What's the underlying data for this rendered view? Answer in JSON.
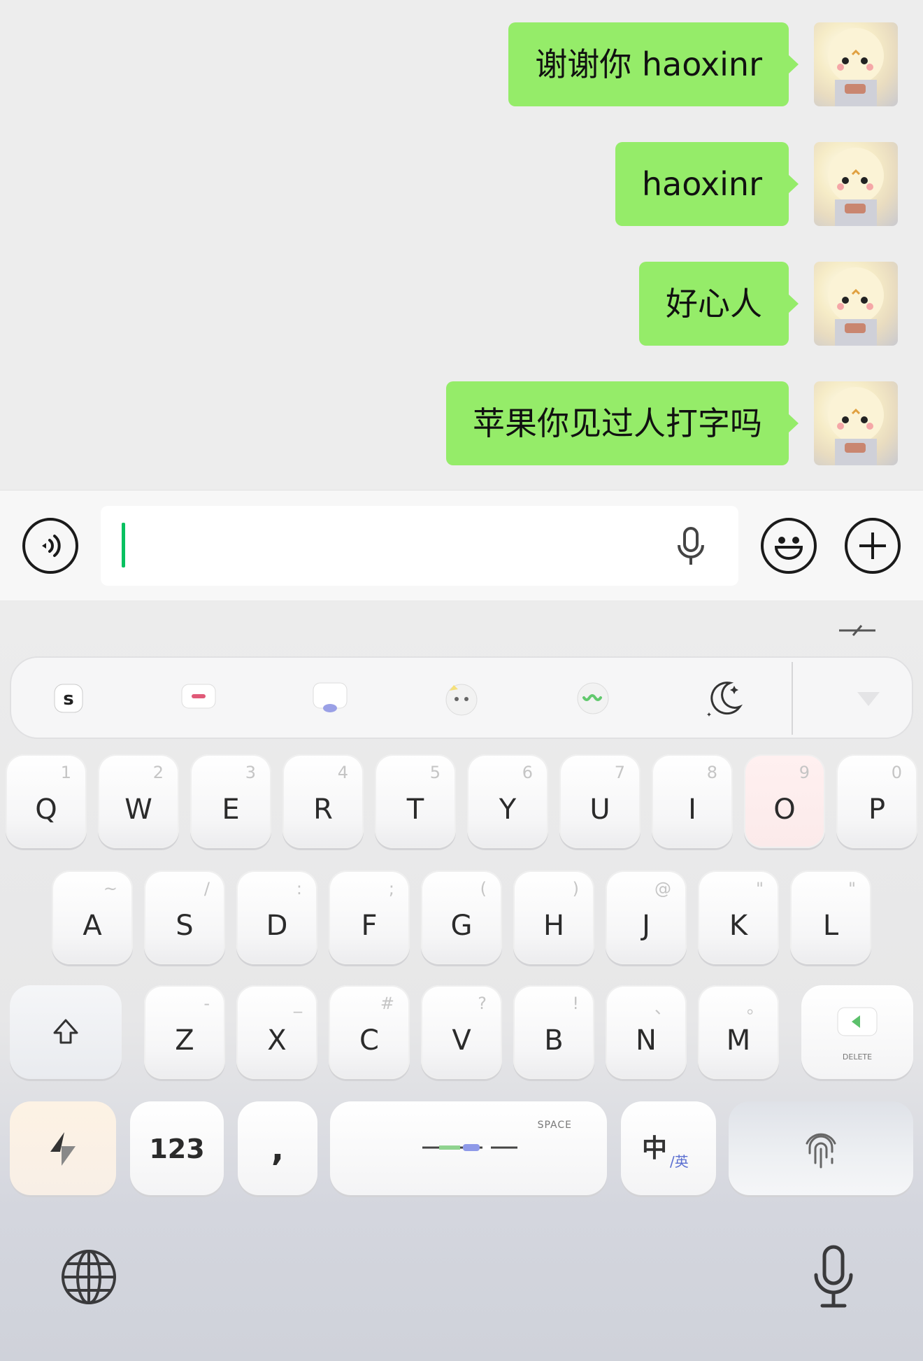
{
  "chat": {
    "messages": [
      {
        "text": "谢谢你 haoxinr",
        "from": "me"
      },
      {
        "text": "haoxinr",
        "from": "me"
      },
      {
        "text": "好心人",
        "from": "me"
      },
      {
        "text": "苹果你见过人打字吗",
        "from": "me"
      }
    ],
    "bubble_color": "#95ec69"
  },
  "input_bar": {
    "left_icon": "voice-message-icon",
    "input_value": "",
    "mic_icon": "microphone-icon",
    "emoji_icon": "emoji-icon",
    "plus_icon": "plus-icon"
  },
  "keyboard": {
    "toolbar_icons": [
      "sogou-logo-icon",
      "clipboard-icon",
      "skin-icon",
      "emoticon-icon",
      "voice-input-icon",
      "night-mode-icon",
      "collapse-icon"
    ],
    "rows": [
      [
        {
          "key": "Q",
          "sub": "1"
        },
        {
          "key": "W",
          "sub": "2"
        },
        {
          "key": "E",
          "sub": "3"
        },
        {
          "key": "R",
          "sub": "4"
        },
        {
          "key": "T",
          "sub": "5"
        },
        {
          "key": "Y",
          "sub": "6"
        },
        {
          "key": "U",
          "sub": "7"
        },
        {
          "key": "I",
          "sub": "8"
        },
        {
          "key": "O",
          "sub": "9"
        },
        {
          "key": "P",
          "sub": "0"
        }
      ],
      [
        {
          "key": "A",
          "sub": "~"
        },
        {
          "key": "S",
          "sub": "/"
        },
        {
          "key": "D",
          "sub": ":"
        },
        {
          "key": "F",
          "sub": ";"
        },
        {
          "key": "G",
          "sub": "("
        },
        {
          "key": "H",
          "sub": ")"
        },
        {
          "key": "J",
          "sub": "@"
        },
        {
          "key": "K",
          "sub": "\""
        },
        {
          "key": "L",
          "sub": "\""
        }
      ],
      [
        {
          "key": "Z",
          "sub": "-"
        },
        {
          "key": "X",
          "sub": "_"
        },
        {
          "key": "C",
          "sub": "#"
        },
        {
          "key": "V",
          "sub": "?"
        },
        {
          "key": "B",
          "sub": "!"
        },
        {
          "key": "N",
          "sub": "、"
        },
        {
          "key": "M",
          "sub": "。"
        }
      ]
    ],
    "shift_icon": "shift-icon",
    "delete_label": "DELETE",
    "num_label": "123",
    "comma_label": ",",
    "space_label": "SPACE",
    "lang_main": "中",
    "lang_sub": "/英",
    "enter_icon": "fingerprint-icon",
    "accent": "#07c160"
  },
  "system_bar": {
    "globe_icon": "globe-icon",
    "dictation_icon": "microphone-icon"
  }
}
